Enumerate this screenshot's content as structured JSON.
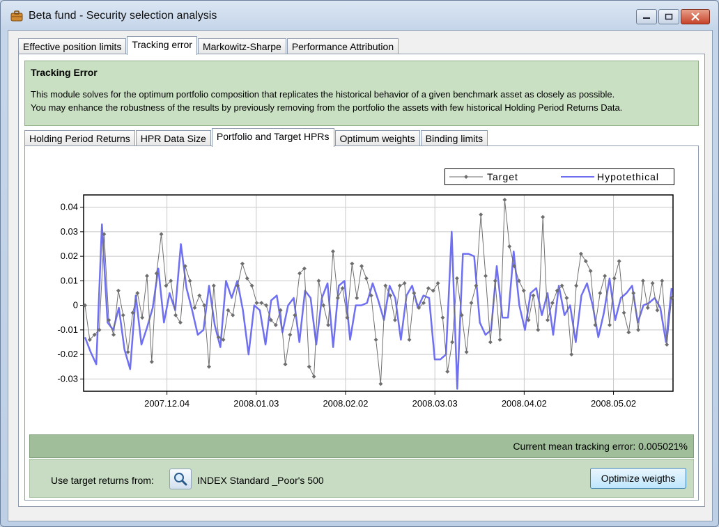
{
  "window": {
    "title": "Beta fund - Security selection analysis"
  },
  "main_tabs": [
    {
      "label": "Effective position limits",
      "active": false
    },
    {
      "label": "Tracking error",
      "active": true
    },
    {
      "label": "Markowitz-Sharpe",
      "active": false
    },
    {
      "label": "Performance Attribution",
      "active": false
    }
  ],
  "info": {
    "title": "Tracking Error",
    "line1": "This module solves for the optimum portfolio composition that replicates the historical behavior of a given benchmark asset as closely as possible.",
    "line2": "You may enhance the robustness of the results by previously removing from the portfolio the assets with few historical Holding Period Returns Data."
  },
  "sub_tabs": [
    {
      "label": "Holding Period Returns",
      "active": false
    },
    {
      "label": "HPR Data Size",
      "active": false
    },
    {
      "label": "Portfolio and Target HPRs",
      "active": true
    },
    {
      "label": "Optimum weights",
      "active": false
    },
    {
      "label": "Binding limits",
      "active": false
    }
  ],
  "chart_data": {
    "type": "line",
    "legend": {
      "placement": "top-right",
      "entries": [
        "Target",
        "Hypotethical"
      ]
    },
    "colors": {
      "Target": "#6e6e6e",
      "Hypotethical": "#6f6ff2"
    },
    "ylim": [
      -0.035,
      0.045
    ],
    "yticks": [
      -0.03,
      -0.02,
      -0.01,
      0,
      0.01,
      0.02,
      0.03,
      0.04
    ],
    "ytick_labels": [
      "-0.03",
      "-0.02",
      "-0.01",
      "0",
      "0.01",
      "0.02",
      "0.03",
      "0.04"
    ],
    "xticks": [
      "2007.12.04",
      "2008.01.03",
      "2008.02.02",
      "2008.03.03",
      "2008.04.02",
      "2008.05.02"
    ],
    "grid": true,
    "x_days_range": [
      -28,
      170
    ],
    "xtick_days": [
      0,
      30,
      60,
      90,
      120,
      150
    ],
    "series": [
      {
        "name": "Target",
        "values": [
          0.0,
          -0.014,
          -0.012,
          -0.01,
          0.029,
          -0.006,
          -0.012,
          0.006,
          -0.004,
          -0.019,
          -0.003,
          0.005,
          -0.005,
          0.012,
          -0.023,
          0.013,
          0.029,
          0.008,
          0.01,
          -0.004,
          -0.007,
          0.016,
          0.01,
          -0.001,
          0.004,
          0.0,
          -0.025,
          0.008,
          -0.013,
          -0.014,
          -0.002,
          -0.004,
          0.008,
          0.017,
          0.011,
          0.008,
          0.001,
          0.001,
          0.0,
          -0.006,
          -0.008,
          -0.002,
          -0.024,
          -0.012,
          -0.004,
          0.013,
          0.015,
          -0.025,
          -0.029,
          0.01,
          0.0,
          -0.008,
          0.022,
          0.003,
          0.007,
          -0.005,
          0.017,
          0.003,
          0.016,
          0.011,
          0.004,
          -0.014,
          -0.032,
          0.008,
          0.004,
          -0.006,
          0.008,
          0.009,
          -0.014,
          0.005,
          -0.001,
          0.001,
          0.007,
          0.006,
          0.009,
          -0.005,
          -0.027,
          -0.015,
          0.011,
          -0.004,
          -0.019,
          0.001,
          0.008,
          0.037,
          0.012,
          -0.015,
          0.01,
          -0.014,
          0.043,
          0.024,
          0.016,
          0.01,
          0.006,
          -0.006,
          0.004,
          -0.01,
          0.036,
          -0.006,
          0.001,
          0.006,
          0.008,
          0.003,
          -0.02,
          0.008,
          0.021,
          0.018,
          0.014,
          -0.008,
          0.005,
          0.012,
          -0.008,
          0.011,
          0.018,
          -0.003,
          -0.011,
          0.005,
          -0.01,
          0.01,
          -0.001,
          0.009,
          -0.002,
          0.01,
          -0.016,
          0.003
        ]
      },
      {
        "name": "Hypotethical",
        "values": [
          -0.013,
          -0.019,
          -0.024,
          0.033,
          -0.007,
          -0.01,
          -0.001,
          -0.018,
          -0.026,
          0.004,
          -0.016,
          -0.009,
          -0.001,
          0.015,
          -0.007,
          0.005,
          -0.002,
          0.025,
          0.007,
          -0.002,
          -0.012,
          -0.01,
          0.008,
          -0.008,
          -0.017,
          0.01,
          0.003,
          0.01,
          -0.002,
          -0.02,
          0.0,
          -0.002,
          -0.016,
          0.002,
          0.004,
          -0.011,
          0.0,
          0.003,
          -0.015,
          0.006,
          0.003,
          -0.016,
          0.003,
          0.009,
          -0.017,
          0.008,
          0.01,
          -0.014,
          0.0,
          0.0,
          0.001,
          0.009,
          0.002,
          -0.006,
          0.008,
          0.003,
          -0.014,
          0.004,
          0.008,
          -0.001,
          0.004,
          0.003,
          -0.022,
          -0.022,
          -0.02,
          0.03,
          -0.034,
          0.021,
          0.021,
          0.02,
          -0.007,
          -0.012,
          -0.01,
          0.016,
          -0.005,
          -0.005,
          0.022,
          0.0,
          -0.01,
          0.005,
          0.007,
          -0.004,
          0.005,
          -0.012,
          0.008,
          -0.004,
          0.0,
          -0.015,
          0.004,
          0.009,
          0.0,
          -0.013,
          -0.003,
          0.011,
          -0.006,
          0.003,
          0.005,
          0.008,
          -0.007,
          0.0,
          0.001,
          0.003,
          -0.001,
          -0.015,
          0.007
        ]
      }
    ]
  },
  "status": {
    "text": "Current mean tracking error: 0.005021%"
  },
  "bottom": {
    "use_label": "Use target returns from:",
    "index_label": "INDEX Standard _Poor's 500",
    "optimize_label": "Optimize weigths"
  }
}
